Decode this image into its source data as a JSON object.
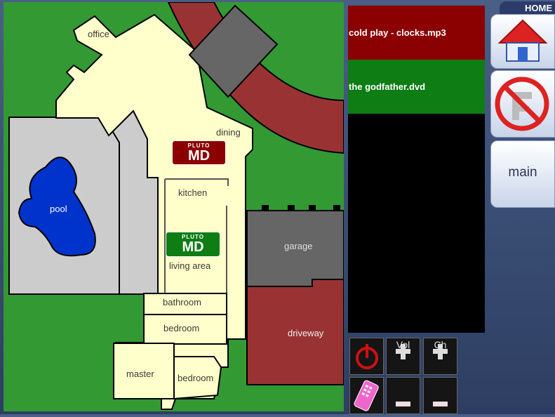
{
  "map": {
    "rooms": {
      "office": "office",
      "dining": "dining",
      "kitchen": "kitchen",
      "pool": "pool",
      "living_area": "living area",
      "garage": "garage",
      "bathroom": "bathroom",
      "bedroom1": "bedroom",
      "driveway": "driveway",
      "master": "master",
      "bedroom2": "bedroom"
    },
    "badges": [
      {
        "small": "PLUTO",
        "big": "MD",
        "color": "#8b0000"
      },
      {
        "small": "PLUTO",
        "big": "MD",
        "color": "#0e7d14"
      }
    ]
  },
  "playlist": {
    "items": [
      {
        "label": "cold play - clocks.mp3",
        "color": "#8b0000"
      },
      {
        "label": "the godfather.dvd",
        "color": "#0e7d14"
      }
    ]
  },
  "controls": {
    "power_icon": "power-icon",
    "vol_label": "Vol",
    "ch_label": "Ch",
    "remote_icon": "remote-icon",
    "minus_icon": "minus-icon"
  },
  "side": {
    "home_label": "HOME",
    "home_icon": "house-icon",
    "floor_icon": "no-floorplan-icon",
    "main_label": "main"
  }
}
